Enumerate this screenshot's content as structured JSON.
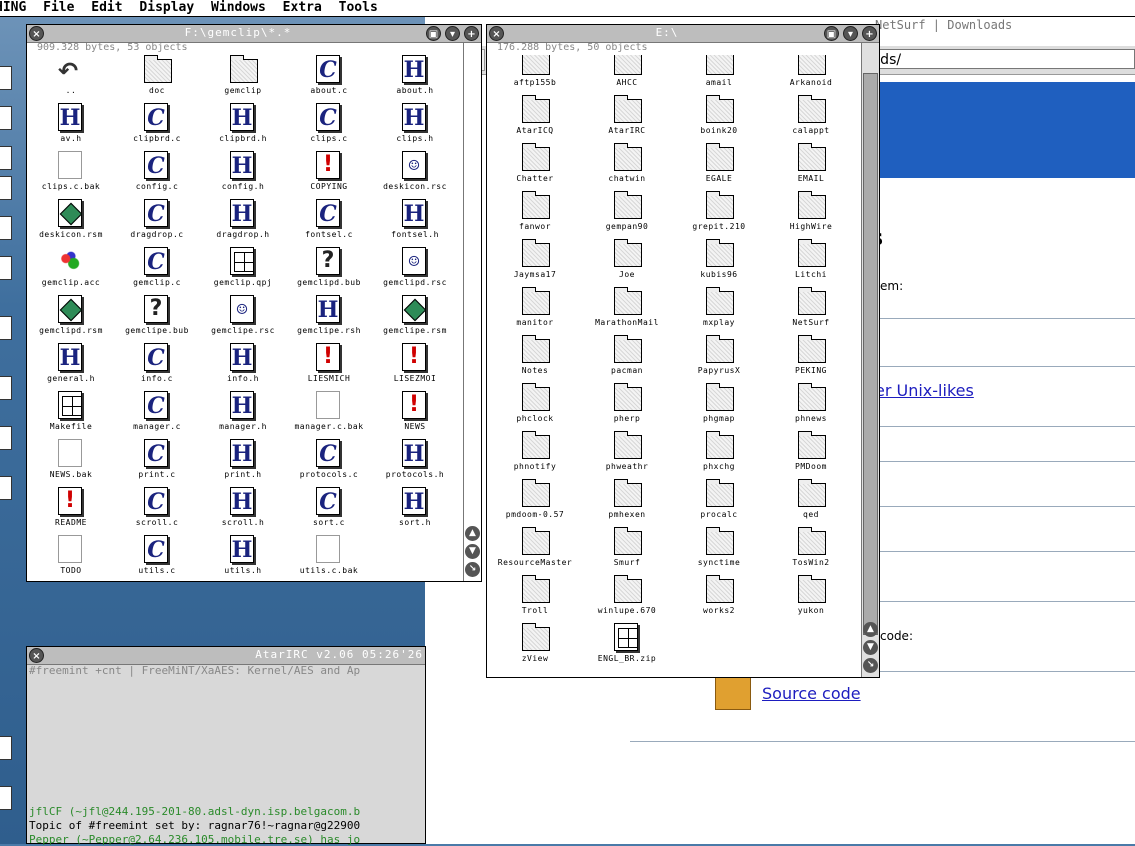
{
  "menubar": {
    "app": "HING",
    "items": [
      "File",
      "Edit",
      "Display",
      "Windows",
      "Extra",
      "Tools"
    ]
  },
  "browser": {
    "tab_title": "NetSurf | Downloads",
    "url": "http://www.netsurf-browser.org/downloads/",
    "fragments": {
      "heading": "s",
      "line1": "em:",
      "link_unix": "er Unix-likes",
      "line2": "code:",
      "source_link": "Source code"
    }
  },
  "win_left": {
    "title": "F:\\gemclip\\*.*",
    "info": "909.328 bytes, 53 objects",
    "items": [
      {
        "name": "..",
        "type": "back"
      },
      {
        "name": "doc",
        "type": "folder"
      },
      {
        "name": "gemclip",
        "type": "folder"
      },
      {
        "name": "about.c",
        "type": "c"
      },
      {
        "name": "about.h",
        "type": "h"
      },
      {
        "name": "av.h",
        "type": "h"
      },
      {
        "name": "clipbrd.c",
        "type": "c"
      },
      {
        "name": "clipbrd.h",
        "type": "h"
      },
      {
        "name": "clips.c",
        "type": "c"
      },
      {
        "name": "clips.h",
        "type": "h"
      },
      {
        "name": "clips.c.bak",
        "type": "plain"
      },
      {
        "name": "config.c",
        "type": "c"
      },
      {
        "name": "config.h",
        "type": "h"
      },
      {
        "name": "COPYING",
        "type": "excl"
      },
      {
        "name": "deskicon.rsc",
        "type": "rsc"
      },
      {
        "name": "deskicon.rsm",
        "type": "rsm"
      },
      {
        "name": "dragdrop.c",
        "type": "c"
      },
      {
        "name": "dragdrop.h",
        "type": "h"
      },
      {
        "name": "fontsel.c",
        "type": "c"
      },
      {
        "name": "fontsel.h",
        "type": "h"
      },
      {
        "name": "gemclip.acc",
        "type": "acc"
      },
      {
        "name": "gemclip.c",
        "type": "c"
      },
      {
        "name": "gemclip.qpj",
        "type": "grid"
      },
      {
        "name": "gemclipd.bub",
        "type": "q"
      },
      {
        "name": "gemclipd.rsc",
        "type": "rsc"
      },
      {
        "name": "gemclipd.rsm",
        "type": "rsm"
      },
      {
        "name": "gemclipe.bub",
        "type": "q"
      },
      {
        "name": "gemclipe.rsc",
        "type": "rsc"
      },
      {
        "name": "gemclipe.rsh",
        "type": "h"
      },
      {
        "name": "gemclipe.rsm",
        "type": "rsm"
      },
      {
        "name": "general.h",
        "type": "h"
      },
      {
        "name": "info.c",
        "type": "c"
      },
      {
        "name": "info.h",
        "type": "h"
      },
      {
        "name": "LIESMICH",
        "type": "excl"
      },
      {
        "name": "LISEZMOI",
        "type": "excl"
      },
      {
        "name": "Makefile",
        "type": "grid"
      },
      {
        "name": "manager.c",
        "type": "c"
      },
      {
        "name": "manager.h",
        "type": "h"
      },
      {
        "name": "manager.c.bak",
        "type": "plain"
      },
      {
        "name": "NEWS",
        "type": "excl"
      },
      {
        "name": "NEWS.bak",
        "type": "plain"
      },
      {
        "name": "print.c",
        "type": "c"
      },
      {
        "name": "print.h",
        "type": "h"
      },
      {
        "name": "protocols.c",
        "type": "c"
      },
      {
        "name": "protocols.h",
        "type": "h"
      },
      {
        "name": "README",
        "type": "excl"
      },
      {
        "name": "scroll.c",
        "type": "c"
      },
      {
        "name": "scroll.h",
        "type": "h"
      },
      {
        "name": "sort.c",
        "type": "c"
      },
      {
        "name": "sort.h",
        "type": "h"
      },
      {
        "name": "TODO",
        "type": "plain"
      },
      {
        "name": "utils.c",
        "type": "c"
      },
      {
        "name": "utils.h",
        "type": "h"
      },
      {
        "name": "utils.c.bak",
        "type": "plain"
      }
    ]
  },
  "win_right": {
    "title": "E:\\",
    "info": "176.288 bytes, 50 objects",
    "items": [
      {
        "name": "aftp155b",
        "type": "folder"
      },
      {
        "name": "AHCC",
        "type": "folder"
      },
      {
        "name": "amail",
        "type": "folder"
      },
      {
        "name": "Arkanoid",
        "type": "folder"
      },
      {
        "name": "AtarICQ",
        "type": "folder"
      },
      {
        "name": "AtarIRC",
        "type": "folder"
      },
      {
        "name": "boink20",
        "type": "folder"
      },
      {
        "name": "calappt",
        "type": "folder"
      },
      {
        "name": "Chatter",
        "type": "folder"
      },
      {
        "name": "chatwin",
        "type": "folder"
      },
      {
        "name": "EGALE",
        "type": "folder"
      },
      {
        "name": "EMAIL",
        "type": "folder"
      },
      {
        "name": "fanwor",
        "type": "folder"
      },
      {
        "name": "gempan90",
        "type": "folder"
      },
      {
        "name": "grepit.210",
        "type": "folder"
      },
      {
        "name": "HighWire",
        "type": "folder"
      },
      {
        "name": "Jaymsa17",
        "type": "folder"
      },
      {
        "name": "Joe",
        "type": "folder"
      },
      {
        "name": "kubis96",
        "type": "folder"
      },
      {
        "name": "Litchi",
        "type": "folder"
      },
      {
        "name": "manitor",
        "type": "folder"
      },
      {
        "name": "MarathonMail",
        "type": "folder"
      },
      {
        "name": "mxplay",
        "type": "folder"
      },
      {
        "name": "NetSurf",
        "type": "folder"
      },
      {
        "name": "Notes",
        "type": "folder"
      },
      {
        "name": "pacman",
        "type": "folder"
      },
      {
        "name": "PapyrusX",
        "type": "folder"
      },
      {
        "name": "PEKING",
        "type": "folder"
      },
      {
        "name": "phclock",
        "type": "folder"
      },
      {
        "name": "pherp",
        "type": "folder"
      },
      {
        "name": "phgmap",
        "type": "folder"
      },
      {
        "name": "phnews",
        "type": "folder"
      },
      {
        "name": "phnotify",
        "type": "folder"
      },
      {
        "name": "phweathr",
        "type": "folder"
      },
      {
        "name": "phxchg",
        "type": "folder"
      },
      {
        "name": "PMDoom",
        "type": "folder"
      },
      {
        "name": "pmdoom-0.57",
        "type": "folder"
      },
      {
        "name": "pmhexen",
        "type": "folder"
      },
      {
        "name": "procalc",
        "type": "folder"
      },
      {
        "name": "qed",
        "type": "folder"
      },
      {
        "name": "ResourceMaster",
        "type": "folder"
      },
      {
        "name": "Smurf",
        "type": "folder"
      },
      {
        "name": "synctime",
        "type": "folder"
      },
      {
        "name": "TosWin2",
        "type": "folder"
      },
      {
        "name": "Troll",
        "type": "folder"
      },
      {
        "name": "winlupe.670",
        "type": "folder"
      },
      {
        "name": "works2",
        "type": "folder"
      },
      {
        "name": "yukon",
        "type": "folder"
      },
      {
        "name": "zView",
        "type": "folder"
      },
      {
        "name": "ENGL_BR.zip",
        "type": "zip"
      }
    ]
  },
  "irc": {
    "title": "AtarIRC v2.06  05:26'26",
    "topic": "#freemint +cnt | FreeMiNT/XaAES: Kernel/AES and Ap",
    "lines": [
      {
        "text": "jflCF (~jfl@244.195-201-80.adsl-dyn.isp.belgacom.b",
        "color": "#2a8a2a"
      },
      {
        "text": "Topic of #freemint set by: ragnar76!~ragnar@g22900",
        "color": "#000000"
      },
      {
        "text": "Pepper (~Pepper@2.64.236.105.mobile.tre.se) has jo",
        "color": "#2a8a2a"
      }
    ]
  }
}
